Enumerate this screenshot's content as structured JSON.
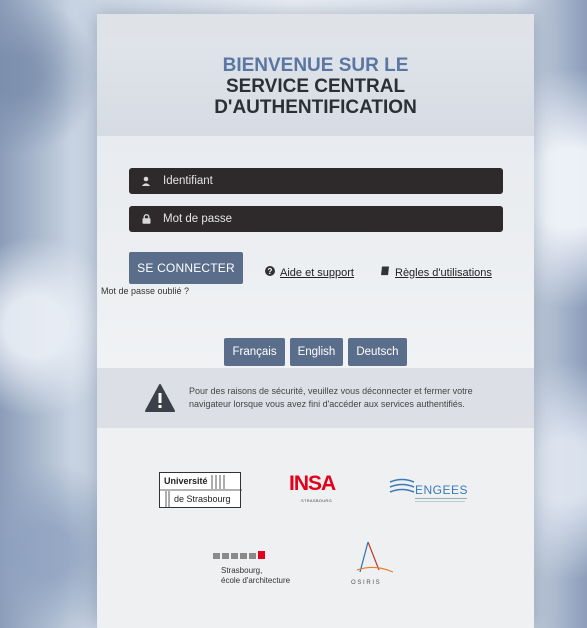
{
  "title": {
    "line1": "BIENVENUE SUR LE",
    "line2": "SERVICE CENTRAL",
    "line3": "D'AUTHENTIFICATION"
  },
  "form": {
    "username_placeholder": "Identifiant",
    "password_placeholder": "Mot de passe",
    "login_label": "SE CONNECTER",
    "forgot_label": "Mot de passe oublié ?",
    "help_label": "Aide et support",
    "rules_label": "Règles d'utilisations"
  },
  "languages": [
    "Français",
    "English",
    "Deutsch"
  ],
  "warning": {
    "text": "Pour des raisons de sécurité, veuillez vous déconnecter et fermer votre navigateur lorsque vous avez fini d'accéder aux services authentifiés."
  },
  "logos": {
    "unistra_line1": "Université",
    "unistra_line2": "de Strasbourg",
    "insa": "INSA",
    "insa_sub": "STRASBOURG",
    "engees": "ENGEES",
    "archi_line1": "Strasbourg,",
    "archi_line2": "école d'architecture",
    "osiris": "O S I R I S"
  },
  "colors": {
    "accent": "#5a6e8c",
    "title_blue": "#5a76a2",
    "field_bg": "#2e2a2c",
    "insa_red": "#e3001b",
    "engees_blue": "#3a7ab8"
  }
}
